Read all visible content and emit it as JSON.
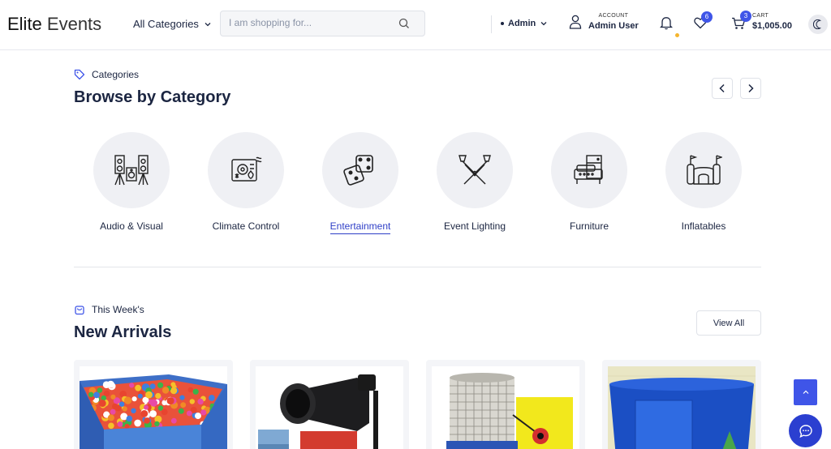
{
  "header": {
    "logo_bold": "Elite",
    "logo_rest": " Events",
    "category_dropdown": "All Categories",
    "search_placeholder": "I am shopping for...",
    "role": "Admin",
    "account_small": "ACCOUNT",
    "account_name": "Admin User",
    "wishlist_count": "6",
    "cart_count": "3",
    "cart_small": "CART",
    "cart_total": "$1,005.00"
  },
  "categories_section": {
    "eyebrow": "Categories",
    "title": "Browse by Category",
    "items": [
      {
        "label": "Audio & Visual",
        "icon": "speakers-icon"
      },
      {
        "label": "Climate Control",
        "icon": "climate-icon"
      },
      {
        "label": "Entertainment",
        "icon": "dice-icon"
      },
      {
        "label": "Event Lighting",
        "icon": "spotlights-icon"
      },
      {
        "label": "Furniture",
        "icon": "furniture-icon"
      },
      {
        "label": "Inflatables",
        "icon": "bounce-castle-icon"
      }
    ],
    "active_index": 2
  },
  "arrivals_section": {
    "eyebrow": "This Week's",
    "title": "New Arrivals",
    "view_all": "View All",
    "products": [
      {
        "image": "ball-pit-image"
      },
      {
        "image": "fan-blower-image"
      },
      {
        "image": "dunk-tank-image"
      },
      {
        "image": "blue-tub-image"
      }
    ]
  },
  "colors": {
    "primary": "#3f55e8",
    "text": "#1b2541",
    "active_link": "#2f3fc7",
    "notification_dot": "#f5b52e"
  }
}
